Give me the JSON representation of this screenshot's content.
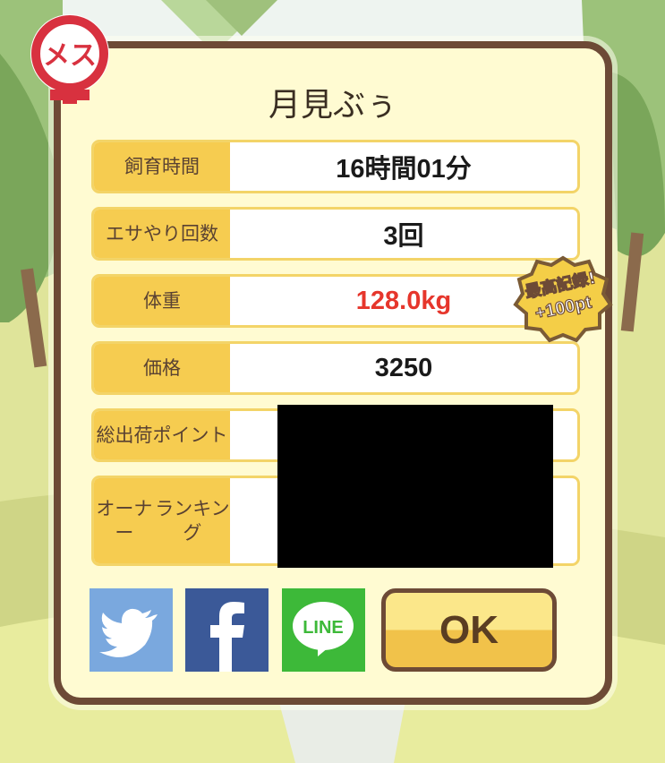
{
  "pet_name": "月見ぶぅ",
  "gender_badge": {
    "text": "メス",
    "icon": "female-symbol-icon"
  },
  "rows": [
    {
      "label": "飼育時間",
      "value": "16時間01分"
    },
    {
      "label": "エサやり回数",
      "value": "3回"
    },
    {
      "label": "体重",
      "value": "128.0kg"
    },
    {
      "label": "価格",
      "value": "3250"
    },
    {
      "label_line1": "総出荷",
      "label_line2": "ポイント",
      "value": ""
    },
    {
      "label_line1": "オーナー",
      "label_line2": "ランキング",
      "value": ""
    }
  ],
  "record_badge": {
    "line1": "最高記録!",
    "line2": "+100pt"
  },
  "share": [
    {
      "icon": "twitter-icon",
      "color": "#7aa8de"
    },
    {
      "icon": "facebook-icon",
      "color": "#3b5998"
    },
    {
      "icon": "line-icon",
      "text": "LINE",
      "color": "#3db939"
    }
  ],
  "ok_label": "OK",
  "colors": {
    "highlight_value": "#e6362c",
    "label_bg": "#f6cc50",
    "frame": "#6d4a36"
  }
}
